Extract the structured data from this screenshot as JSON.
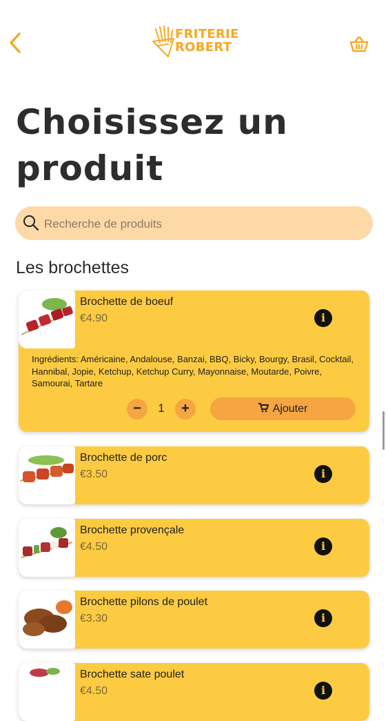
{
  "header": {
    "back_icon": "chevron-left-icon",
    "logo_line1": "FRITERIE",
    "logo_line2": "ROBERT",
    "cart_icon": "basket-icon",
    "accent_color": "#f6a823"
  },
  "page_title": "Choisissez un produit",
  "search": {
    "placeholder": "Recherche de produits",
    "icon": "search-icon"
  },
  "section_title": "Les brochettes",
  "colors": {
    "card_bg": "#fdcb42",
    "button_bg": "#f5a541",
    "search_bg": "#fdd9a8"
  },
  "products": [
    {
      "name": "Brochette de boeuf",
      "price": "€4.90",
      "expanded": true,
      "ingredients": "Ingrédients: Américaine, Andalouse, Banzai, BBQ, Bicky, Bourgy, Brasil, Cocktail, Hannibal, Jopie, Ketchup, Ketchup Curry, Mayonnaise, Moutarde, Poivre, Samourai, Tartare",
      "quantity": "1",
      "add_label": "Ajouter"
    },
    {
      "name": "Brochette de porc",
      "price": "€3.50"
    },
    {
      "name": "Brochette provençale",
      "price": "€4.50"
    },
    {
      "name": "Brochette pilons de poulet",
      "price": "€3.30"
    },
    {
      "name": "Brochette sate poulet",
      "price": "€4.50"
    }
  ]
}
